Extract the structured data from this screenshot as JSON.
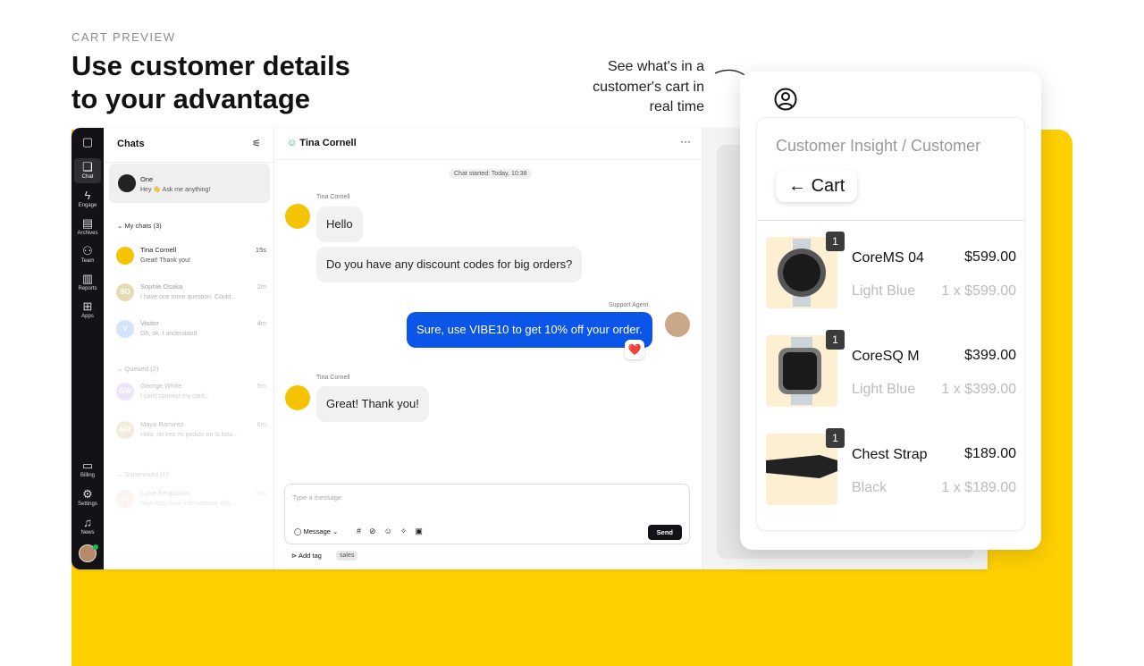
{
  "hero": {
    "eyebrow": "CART PREVIEW",
    "title_line1": "Use customer details",
    "title_line2": "to your advantage",
    "annotation": [
      "See what's in a",
      "customer's cart in",
      "real time"
    ]
  },
  "colors": {
    "accent_yellow": "#ffd000",
    "primary_blue": "#0b55e8",
    "sidebar_dark": "#131317"
  },
  "nav": [
    {
      "label": "Chat",
      "icon": "chat-icon"
    },
    {
      "label": "Engage",
      "icon": "lightning-icon"
    },
    {
      "label": "Archives",
      "icon": "archive-icon"
    },
    {
      "label": "Team",
      "icon": "team-icon"
    },
    {
      "label": "Reports",
      "icon": "chart-icon"
    },
    {
      "label": "Apps",
      "icon": "apps-icon"
    },
    {
      "label": "Billing",
      "icon": "billing-icon"
    },
    {
      "label": "Settings",
      "icon": "gear-icon"
    },
    {
      "label": "News",
      "icon": "bell-icon"
    }
  ],
  "chats": {
    "title": "Chats",
    "bot": {
      "name": "One",
      "preview": "Hey 👋 Ask me anything!"
    },
    "my_chats": "My chats (3)",
    "queued": "Queued (2)",
    "supervised": "Supervised (1)",
    "items": [
      {
        "initials": "",
        "name": "Tina Cornell",
        "preview": "Great! Thank you!",
        "time": "15s",
        "color": "#f5c400"
      },
      {
        "initials": "SO",
        "name": "Sophie Osaka",
        "preview": "I have one more question. Could...",
        "time": "2m",
        "color": "#c9b25a"
      },
      {
        "initials": "V",
        "name": "Visitor",
        "preview": "Oh, ok. I understand",
        "time": "4m",
        "color": "#9cc3f7"
      },
      {
        "initials": "GW",
        "name": "George White",
        "preview": "I can't connect my card...",
        "time": "5m",
        "color": "#c6a8f0"
      },
      {
        "initials": "MR",
        "name": "Maya Ramirez",
        "preview": "Hola, no veo mi pedido en la lista...",
        "time": "6m",
        "color": "#d6c58a"
      },
      {
        "initials": "LF",
        "name": "Luise Fergusson",
        "preview": "How long does international ship...",
        "time": "15s",
        "color": "#f7b9a4"
      }
    ]
  },
  "conversation": {
    "contact": "Tina Cornell",
    "started": "Chat started: Today, 10:38",
    "customer_label": "Tina Cornell",
    "agent_label": "Support Agent",
    "messages": [
      "Hello",
      "Do you have any discount codes for big orders?",
      "Sure, use VIBE10 to get 10% off your order.",
      "Great! Thank you!"
    ],
    "reaction": "❤️",
    "placeholder": "Type a message",
    "mode": "Message",
    "send": "Send",
    "add_tag": "Add tag",
    "tag": "sales"
  },
  "cart": {
    "breadcrumb": "Customer Insight / Customer",
    "back_label": "Cart",
    "products": [
      {
        "qty": "1",
        "name": "CoreMS 04",
        "price": "$599.00",
        "color": "Light Blue",
        "line": "1 x $599.00"
      },
      {
        "qty": "1",
        "name": "CoreSQ M",
        "price": "$399.00",
        "color": "Light Blue",
        "line": "1 x $399.00"
      },
      {
        "qty": "1",
        "name": "Chest Strap",
        "price": "$189.00",
        "color": "Black",
        "line": "1 x $189.00"
      }
    ]
  }
}
